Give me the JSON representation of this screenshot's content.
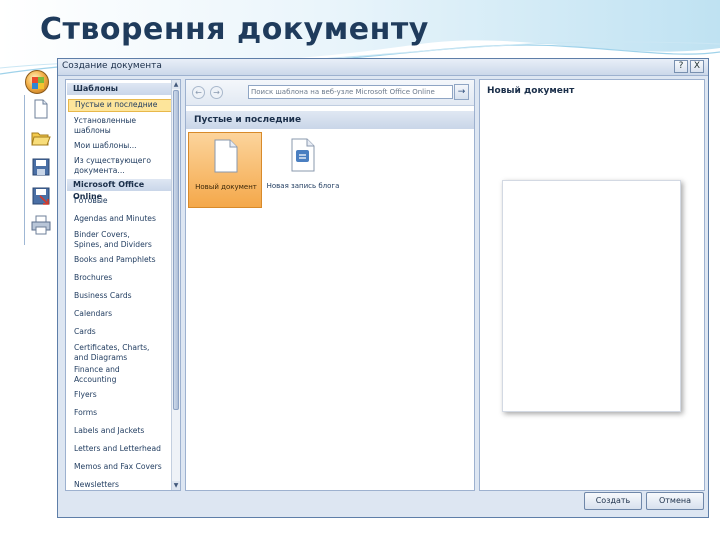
{
  "slide": {
    "title": "Створення документу"
  },
  "dialog": {
    "title": "Создание документа",
    "help_label": "?",
    "close_label": "X"
  },
  "nav": {
    "header_templates": "Шаблоны",
    "items_top": [
      {
        "label": "Пустые и последние",
        "selected": true
      },
      {
        "label": "Установленные шаблоны",
        "selected": false
      },
      {
        "label": "Мои шаблоны...",
        "selected": false
      },
      {
        "label": "Из существующего документа...",
        "selected": false
      }
    ],
    "header_online": "Microsoft Office Online",
    "items_online": [
      "Готовые",
      "Agendas and Minutes",
      "Binder Covers, Spines, and Dividers",
      "Books and Pamphlets",
      "Brochures",
      "Business Cards",
      "Calendars",
      "Cards",
      "Certificates, Charts, and Diagrams",
      "Finance and Accounting",
      "Flyers",
      "Forms",
      "Labels and Jackets",
      "Letters and Letterhead",
      "Memos and Fax Covers",
      "Newsletters"
    ]
  },
  "middle": {
    "search_placeholder": "Поиск шаблона на веб-узле Microsoft Office Online",
    "go_label": "→",
    "back_label": "←",
    "forward_label": "→",
    "section_title": "Пустые и последние",
    "tiles": [
      {
        "label": "Новый документ",
        "selected": true
      },
      {
        "label": "Новая запись блога",
        "selected": false
      }
    ]
  },
  "right": {
    "title": "Новый документ"
  },
  "buttons": {
    "create": "Создать",
    "cancel": "Отмена"
  },
  "colors": {
    "title_text": "#1f3b5c",
    "dialog_bg": "#dde6f2",
    "selection": "#fde59b",
    "tile_selected": "#f4a84a"
  }
}
